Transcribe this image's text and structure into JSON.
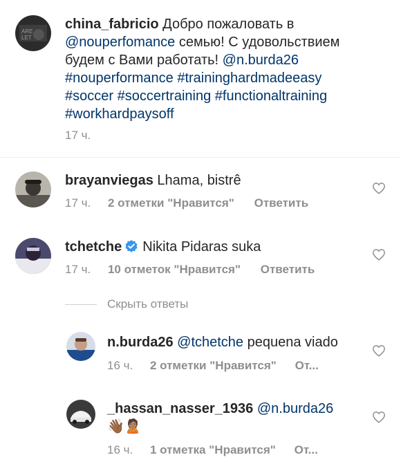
{
  "caption": {
    "username": "china_fabricio",
    "text_line1": "Добро пожаловать в",
    "mention1": "@nouperfomance",
    "text_line2": " семью! С удовольствием",
    "text_line3": "будем с Вами работать! ",
    "mention2": "@n.burda26",
    "tags_line4": "#nouperformance #traininghardmadeeasy",
    "tags_line5": "#soccer #soccertraining #functionaltraining",
    "tags_line6": "#workhardpaysoff",
    "time": "17 ч."
  },
  "comments": [
    {
      "username": "brayanviegas",
      "text": "Lhama, bistrê",
      "time": "17 ч.",
      "likes": "2 отметки \"Нравится\"",
      "reply": "Ответить"
    },
    {
      "username": "tchetche",
      "verified": true,
      "text": "Nikita Pidaras suka",
      "time": "17 ч.",
      "likes": "10 отметок \"Нравится\"",
      "reply": "Ответить"
    }
  ],
  "hide_replies": "Скрыть ответы",
  "replies": [
    {
      "username": "n.burda26",
      "mention": "@tchetche",
      "text": " pequena viado",
      "time": "16 ч.",
      "likes": "2 отметки \"Нравится\"",
      "reply": "От..."
    },
    {
      "username": "_hassan_nasser_1936",
      "mention": "@n.burda26",
      "emoji": "👋🏾🙎🏽",
      "time": "16 ч.",
      "likes": "1 отметка \"Нравится\"",
      "reply": "От..."
    }
  ],
  "colors": {
    "link": "#003569",
    "meta": "#8e8e8e",
    "verified": "#3897f0"
  }
}
